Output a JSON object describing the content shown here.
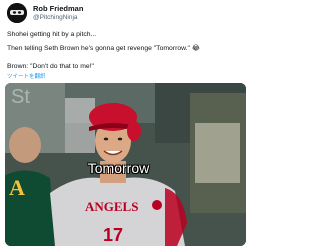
{
  "tweet": {
    "author_name": "Rob Friedman",
    "author_handle": "@PitchingNinja",
    "lines": [
      "Shohei getting hit by a pitch...",
      "Then telling Seth Brown he's gonna get revenge \"Tomorrow.\" 😂",
      "Brown: \"Don't do that to me!\""
    ],
    "translate_link": "ツイートを翻訳"
  },
  "media": {
    "caption": "Tomorrow",
    "jersey_text": "ANGELS",
    "jersey_number": "17",
    "left_jersey_letter": "A",
    "icons": [
      "avatar-ninja-icon"
    ]
  },
  "colors": {
    "link": "#1d9bf0",
    "text": "#0f1419",
    "secondary": "#536471",
    "angels_red": "#ba0021"
  }
}
